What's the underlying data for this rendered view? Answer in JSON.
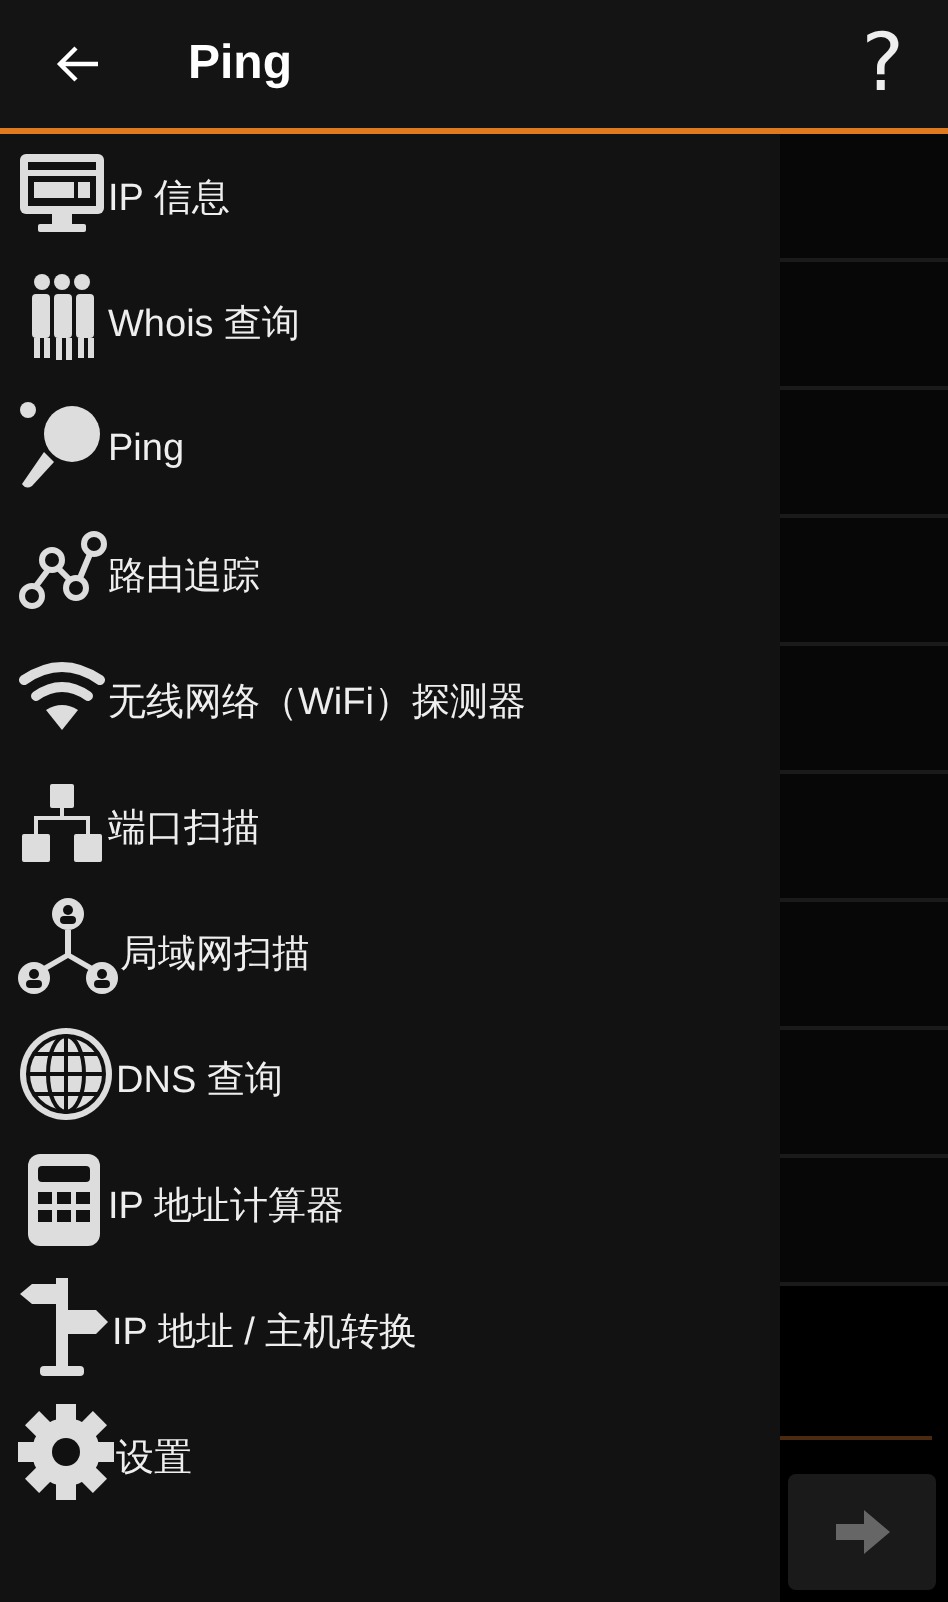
{
  "toolbar": {
    "title": "Ping",
    "help": "?"
  },
  "drawer": {
    "items": [
      {
        "label": "IP 信息"
      },
      {
        "label": "Whois 查询"
      },
      {
        "label": "Ping"
      },
      {
        "label": "路由追踪"
      },
      {
        "label": "无线网络（WiFi）探测器"
      },
      {
        "label": "端口扫描"
      },
      {
        "label": "局域网扫描"
      },
      {
        "label": "DNS 查询"
      },
      {
        "label": "IP 地址计算器"
      },
      {
        "label": "IP 地址 / 主机转换"
      },
      {
        "label": "设置"
      }
    ]
  }
}
